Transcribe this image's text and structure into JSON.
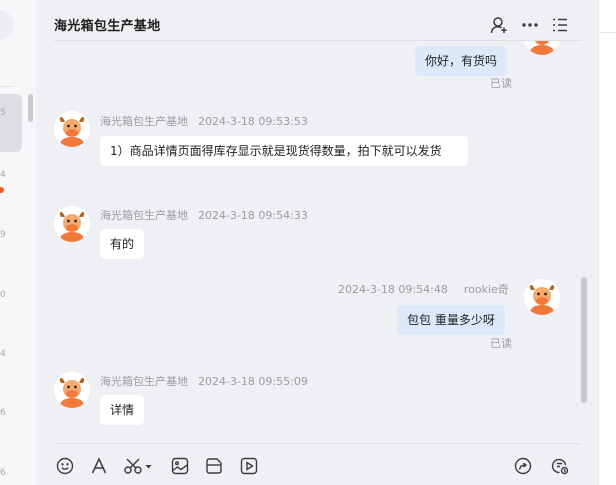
{
  "window": {
    "title": "海光箱包生产基地"
  },
  "left_panel": {
    "digits": [
      "5",
      "4",
      "9",
      "0",
      "4",
      "6",
      "6"
    ]
  },
  "header": {
    "title": "海光箱包生产基地",
    "icons": [
      "add-user-icon",
      "more-icon",
      "list-icon"
    ]
  },
  "messages": [
    {
      "id": "m0",
      "side": "right",
      "sender": "",
      "time": "",
      "text": "你好，有货吗",
      "status": "已读"
    },
    {
      "id": "m1",
      "side": "left",
      "sender": "海光箱包生产基地",
      "time": "2024-3-18 09:53:53",
      "text": "1）商品详情页面得库存显示就是现货得数量，拍下就可以发货",
      "status": ""
    },
    {
      "id": "m2",
      "side": "left",
      "sender": "海光箱包生产基地",
      "time": "2024-3-18 09:54:33",
      "text": "有的",
      "status": ""
    },
    {
      "id": "m3",
      "side": "right",
      "sender": "rookie奇",
      "time": "2024-3-18 09:54:48",
      "text": "包包 重量多少呀",
      "status": "已读"
    },
    {
      "id": "m4",
      "side": "left",
      "sender": "海光箱包生产基地",
      "time": "2024-3-18 09:55:09",
      "text": "详情",
      "status": ""
    }
  ],
  "toolbar": {
    "tools": [
      "emoji-icon",
      "font-icon",
      "screenshot-icon",
      "image-icon",
      "file-icon",
      "video-icon",
      "share-icon",
      "history-icon"
    ]
  },
  "colors": {
    "background": "#eff0f3",
    "my_bubble": "#dde8fb",
    "their_bubble": "#ffffff",
    "avatar_accent": "#f0793b",
    "badge": "#f25a21"
  }
}
